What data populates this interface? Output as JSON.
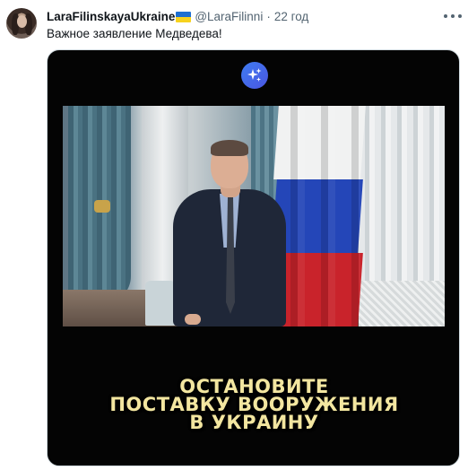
{
  "tweet": {
    "author": {
      "name": "LaraFilinskayaUkraine",
      "flag_icon": "ukraine-flag-icon",
      "handle": "@LaraFilinni",
      "separator": "·",
      "time": "22 год"
    },
    "text": "Важное заявление Медведева!",
    "more_icon": "more-options-icon",
    "media": {
      "badge_icon": "ai-sparkle-icon",
      "caption_lines": [
        "ОСТАНОВИТЕ",
        "ПОСТАВКУ ВООРУЖЕНИЯ",
        "В УКРАИНУ"
      ]
    }
  },
  "colors": {
    "text_primary": "#0f1419",
    "text_secondary": "#536471",
    "badge_blue": "#3f7cf0",
    "caption_yellow": "#f3e6a0"
  }
}
